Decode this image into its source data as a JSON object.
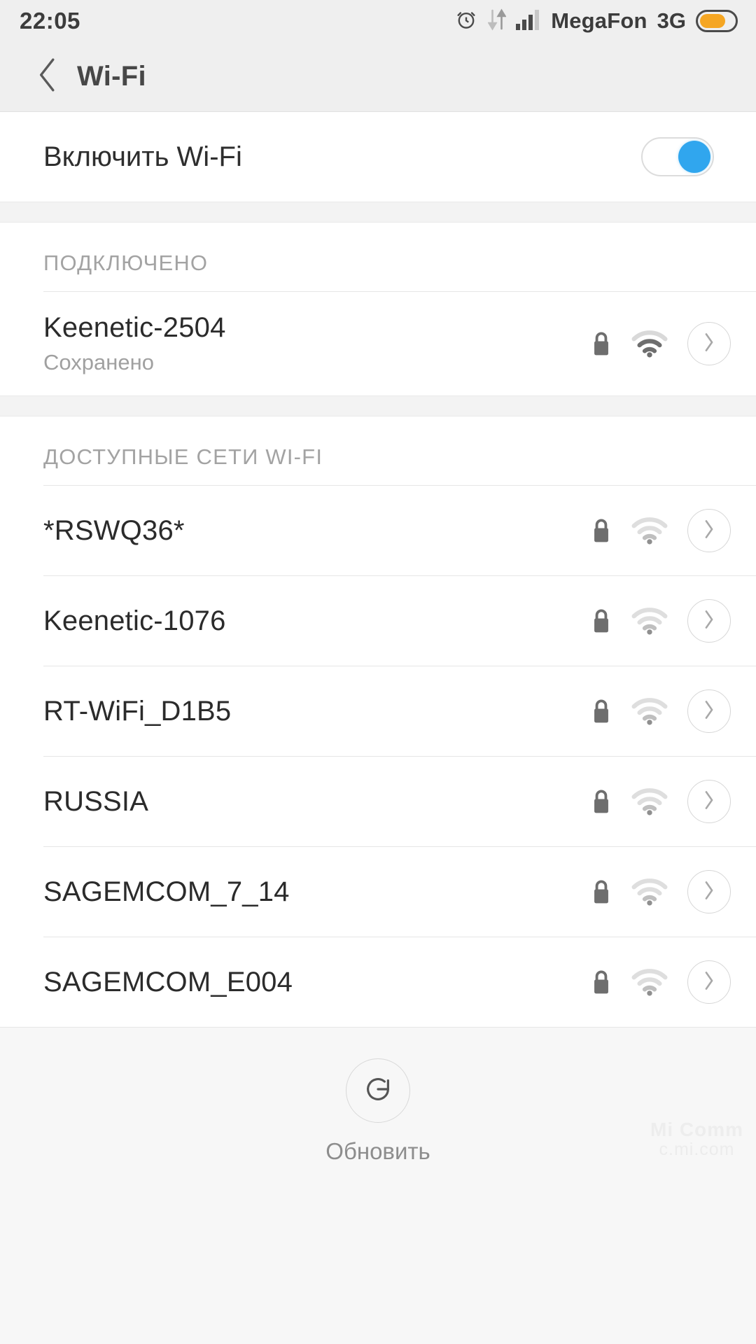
{
  "statusbar": {
    "time": "22:05",
    "carrier": "MegaFon",
    "network_type": "3G",
    "icons": [
      "alarm-icon",
      "data-transfer-icon",
      "signal-bars-icon",
      "battery-icon"
    ],
    "battery_color": "#f5a623",
    "battery_level_pct": 76
  },
  "header": {
    "title": "Wi-Fi",
    "back_icon": "chevron-left-icon"
  },
  "toggle": {
    "label": "Включить Wi-Fi",
    "state": "on",
    "accent_color": "#30a6ee"
  },
  "sections": [
    {
      "title": "ПОДКЛЮЧЕНО",
      "networks": [
        {
          "ssid": "Keenetic-2504",
          "subtitle": "Сохранено",
          "secured": true,
          "signal_bars": 2,
          "signal_max": 3,
          "strong": true
        }
      ]
    },
    {
      "title": "ДОСТУПНЫЕ СЕТИ WI-FI",
      "networks": [
        {
          "ssid": "*RSWQ36*",
          "subtitle": "",
          "secured": true,
          "signal_bars": 1,
          "signal_max": 3,
          "strong": false
        },
        {
          "ssid": "Keenetic-1076",
          "subtitle": "",
          "secured": true,
          "signal_bars": 1,
          "signal_max": 3,
          "strong": false
        },
        {
          "ssid": "RT-WiFi_D1B5",
          "subtitle": "",
          "secured": true,
          "signal_bars": 1,
          "signal_max": 3,
          "strong": false
        },
        {
          "ssid": "RUSSIA",
          "subtitle": "",
          "secured": true,
          "signal_bars": 1,
          "signal_max": 3,
          "strong": false
        },
        {
          "ssid": "SAGEMCOM_7_14",
          "subtitle": "",
          "secured": true,
          "signal_bars": 1,
          "signal_max": 3,
          "strong": false
        },
        {
          "ssid": "SAGEMCOM_E004",
          "subtitle": "",
          "secured": true,
          "signal_bars": 1,
          "signal_max": 3,
          "strong": false
        }
      ]
    }
  ],
  "footer": {
    "refresh_label": "Обновить",
    "refresh_icon": "refresh-scan-icon"
  },
  "watermark": {
    "line1": "Mi Comm",
    "line2": "c.mi.com"
  }
}
